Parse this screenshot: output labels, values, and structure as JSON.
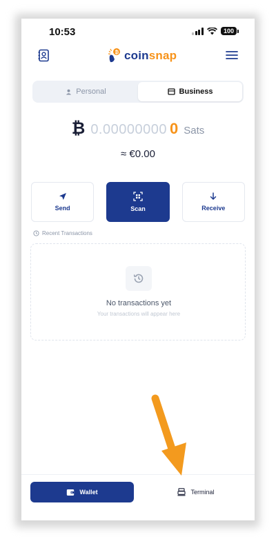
{
  "status_bar": {
    "time": "10:53",
    "battery": "100",
    "icons": [
      "signal-icon",
      "wifi-icon",
      "battery-icon"
    ]
  },
  "header": {
    "brand_prefix": "coin",
    "brand_suffix": "snap",
    "left_icon": "contacts-icon",
    "right_icon": "menu-icon"
  },
  "account_toggle": {
    "options": [
      {
        "label": "Personal",
        "icon": "person-icon",
        "active": false
      },
      {
        "label": "Business",
        "icon": "store-icon",
        "active": true
      }
    ]
  },
  "balance": {
    "currency_symbol": "₿",
    "zeros": "0.00000000",
    "value": "0",
    "unit": "Sats",
    "fiat": "≈ €0.00"
  },
  "actions": [
    {
      "label": "Send",
      "icon": "send-icon"
    },
    {
      "label": "Scan",
      "icon": "scan-icon"
    },
    {
      "label": "Receive",
      "icon": "arrow-down-icon"
    }
  ],
  "recent": {
    "label": "Recent Transactions",
    "empty_title": "No transactions yet",
    "empty_subtitle": "Your transactions will appear here"
  },
  "bottom_nav": {
    "items": [
      {
        "label": "Wallet",
        "icon": "wallet-icon",
        "active": true
      },
      {
        "label": "Terminal",
        "icon": "terminal-icon",
        "active": false
      }
    ]
  },
  "colors": {
    "brand_blue": "#1d3a8f",
    "bitcoin_orange": "#f7931a",
    "annotation_arrow": "#f39a1e"
  }
}
